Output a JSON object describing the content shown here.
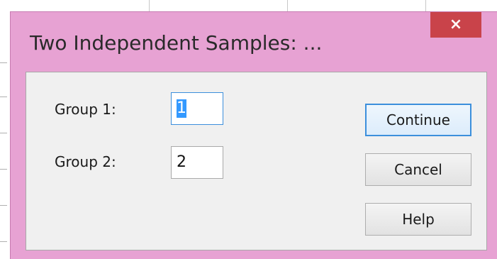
{
  "dialog": {
    "title": "Two Independent Samples: ...",
    "close_glyph": "×",
    "close_icon": "close-icon"
  },
  "fields": {
    "group1": {
      "label": "Group 1:",
      "value": "1"
    },
    "group2": {
      "label": "Group 2:",
      "value": "2"
    }
  },
  "buttons": {
    "continue": "Continue",
    "cancel": "Cancel",
    "help": "Help"
  },
  "colors": {
    "window_frame": "#e7a2d3",
    "close_button": "#c9434a",
    "client_area": "#f0f0f0",
    "focus_accent": "#3c8fdc",
    "selection": "#3399ff"
  }
}
